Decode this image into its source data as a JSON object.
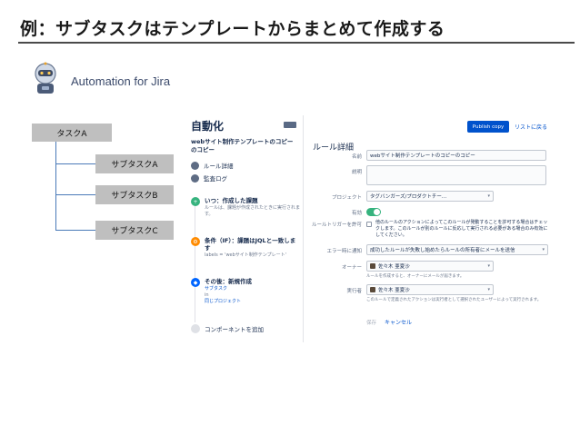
{
  "slide": {
    "title": "例：サブタスクはテンプレートからまとめて作成する",
    "brand": "Automation for Jira"
  },
  "diagram": {
    "parent": "タスクA",
    "children": [
      "サブタスクA",
      "サブタスクB",
      "サブタスクC"
    ]
  },
  "jira": {
    "sidebar": {
      "heading": "自動化",
      "rule_name": "webサイト制作テンプレートのコピーのコピー",
      "nav": [
        "ルール詳細",
        "監査ログ"
      ],
      "steps": [
        {
          "title": "いつ：作成した課題",
          "sub": "ルールは、課題が作成されたときに実行されます。"
        },
        {
          "title": "条件（IF）：課題はJQLと一致します",
          "sub": "labels = 'webサイト制作テンプレート'"
        },
        {
          "title": "その後：新規作成",
          "sub1": "サブタスク",
          "sub2": "in",
          "sub3": "同じプロジェクト"
        }
      ],
      "add_component": "コンポーネントを追加"
    },
    "header": {
      "publish": "Publish copy",
      "back": "リストに戻る"
    },
    "detail": {
      "heading": "ルール詳細",
      "name_label": "名前",
      "name_value": "webサイト制作テンプレートのコピーのコピー",
      "desc_label": "説明",
      "project_label": "プロジェクト",
      "project_value": "タグバンガーズ/プロダクトチー...",
      "enabled_label": "有効",
      "trigger_label": "ルールトリガーを許可",
      "trigger_text": "他のルールのアクションによってこのルールが発動することを許可する場合はチェックします。このルールが別のルールに反応して実行される必要がある場合のみ有効にしてください。",
      "error_label": "エラー時に通知",
      "error_value": "成功したルールが失敗し始めたらルールの所有者にメールを送信",
      "owner_label": "オーナー",
      "owner_value": "佐々木 亜夏沙",
      "owner_help": "ルールを作成すると、オーナーにメールが届きます。",
      "actor_label": "実行者",
      "actor_value": "佐々木 亜夏沙",
      "actor_help": "このルールで定義されたアクションは実行者として選択されたユーザーによって実行されます。",
      "save": "保存",
      "cancel": "キャンセル"
    }
  }
}
